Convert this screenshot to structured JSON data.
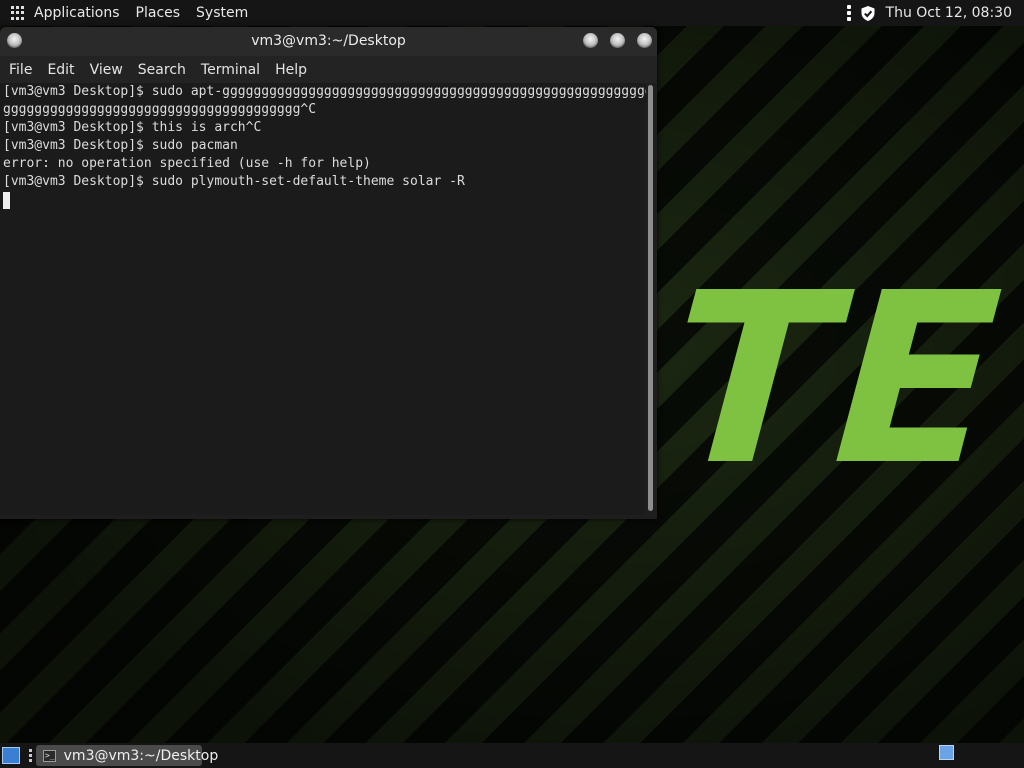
{
  "top_panel": {
    "menus": [
      "Applications",
      "Places",
      "System"
    ],
    "clock": "Thu Oct 12, 08:30"
  },
  "wallpaper": {
    "text": "TE",
    "accent_color": "#7fc241"
  },
  "terminal": {
    "title": "vm3@vm3:~/Desktop",
    "menus": [
      "File",
      "Edit",
      "View",
      "Search",
      "Terminal",
      "Help"
    ],
    "lines": [
      "[vm3@vm3 Desktop]$ sudo apt-ggggggggggggggggggggggggggggggggggggggggggggggggggggggg",
      "gggggggggggggggggggggggggggggggggggggg^C",
      "[vm3@vm3 Desktop]$ this is arch^C",
      "[vm3@vm3 Desktop]$ sudo pacman",
      "error: no operation specified (use -h for help)",
      "[vm3@vm3 Desktop]$ sudo plymouth-set-default-theme solar -R"
    ]
  },
  "taskbar": {
    "window_button": "vm3@vm3:~/Desktop",
    "terminal_icon_glyph": ">_"
  }
}
